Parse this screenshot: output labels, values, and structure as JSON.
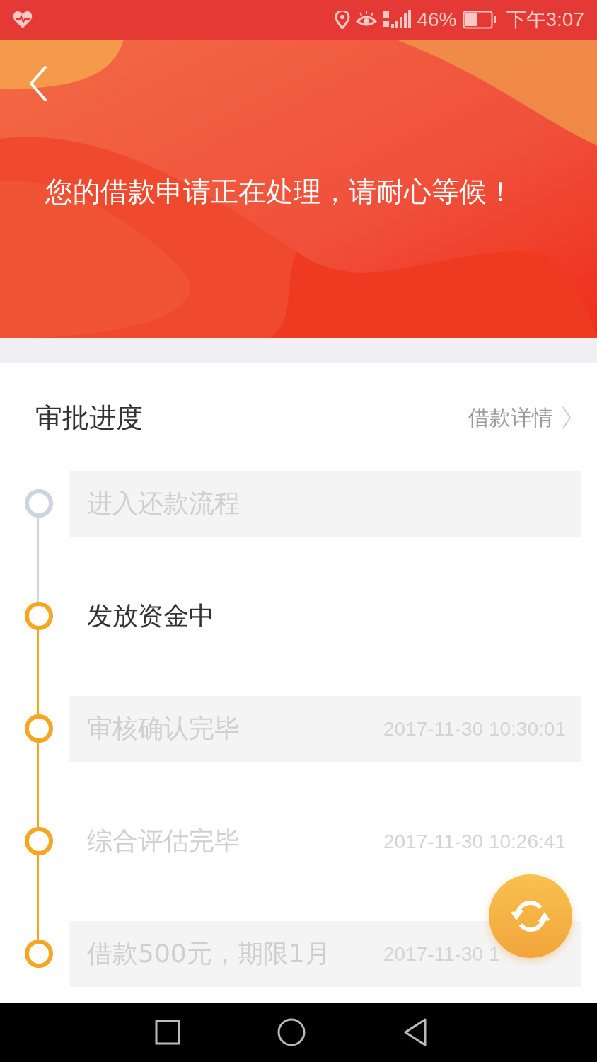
{
  "status_bar": {
    "battery": "46%",
    "time": "下午3:07"
  },
  "header": {
    "message": "您的借款申请正在处理，请耐心等候！"
  },
  "section": {
    "title": "审批进度",
    "link": "借款详情"
  },
  "steps": [
    {
      "label": "进入还款流程",
      "reached": false,
      "current": false
    },
    {
      "label": "发放资金中",
      "reached": true,
      "current": true
    },
    {
      "label": "审核确认完毕",
      "time": "2017-11-30 10:30:01",
      "reached": true,
      "current": false
    },
    {
      "label": "综合评估完毕",
      "time": "2017-11-30 10:26:41",
      "reached": true,
      "current": false
    },
    {
      "label": "借款500元，期限1月",
      "time": "2017-11-30 1",
      "reached": true,
      "current": false
    }
  ]
}
